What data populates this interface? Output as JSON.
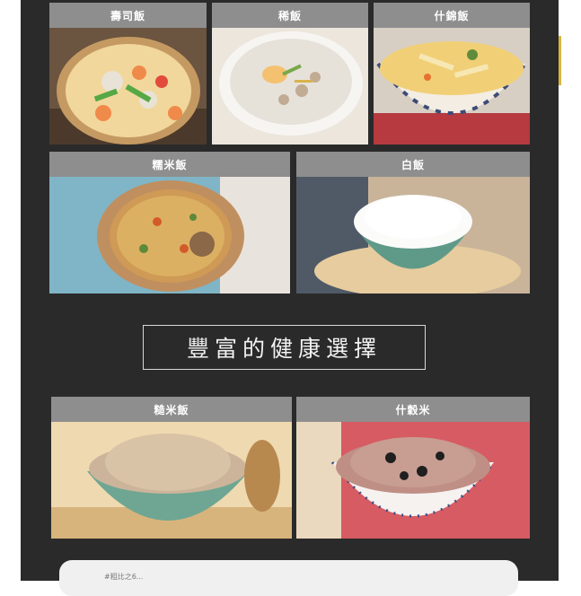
{
  "row1": [
    {
      "label": "壽司飯"
    },
    {
      "label": "稀飯"
    },
    {
      "label": "什錦飯"
    }
  ],
  "row2": [
    {
      "label": "糯米飯"
    },
    {
      "label": "白飯"
    }
  ],
  "banner": {
    "title": "豐富的健康選擇"
  },
  "row3": [
    {
      "label": "糙米飯"
    },
    {
      "label": "什穀米"
    }
  ],
  "footer": {
    "snippet": "#粗比之6..."
  }
}
